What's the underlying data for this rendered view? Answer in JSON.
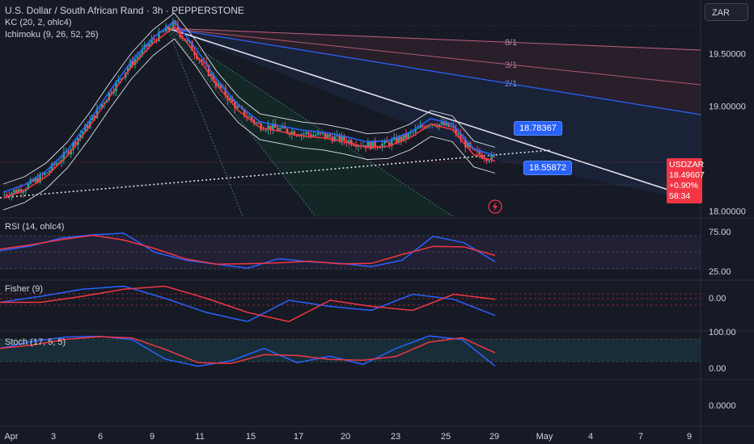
{
  "header": {
    "symbol_line": "U.S. Dollar / South African Rand · 3h · PEPPERSTONE",
    "kc_label": "KC (20, 2, ohlc4)",
    "ichimoku_label": "Ichimoku (9, 26, 52, 26)"
  },
  "currency_button": "ZAR",
  "price_tag": {
    "symbol": "USDZAR",
    "price": "18.49607",
    "change": "+0.90%",
    "countdown": "58:34"
  },
  "annotations": {
    "upper_box": "18.78367",
    "lower_box": "18.55872",
    "fan_labels": [
      "8/1",
      "3/1",
      "2/1"
    ]
  },
  "panes": {
    "rsi": {
      "title": "RSI (14, ohlc4)",
      "ticks": [
        "75.00",
        "25.00"
      ]
    },
    "fisher": {
      "title": "Fisher (9)",
      "ticks": [
        "0.00"
      ]
    },
    "stoch": {
      "title": "Stoch (17, 5, 5)",
      "ticks": [
        "100.00",
        "0.00"
      ]
    },
    "empty": {
      "ticks": [
        "0.0000"
      ]
    }
  },
  "colors": {
    "background": "#161a25",
    "up": "#26a69a",
    "down": "#ef5350",
    "blue": "#2962ff",
    "red": "#f23645"
  },
  "chart_data": {
    "type": "line",
    "title": "U.S. Dollar / South African Rand · 3h · PEPPERSTONE",
    "x_tick_labels": [
      "Apr",
      "3",
      "6",
      "9",
      "11",
      "15",
      "17",
      "20",
      "23",
      "25",
      "29",
      "May",
      "4",
      "7",
      "9"
    ],
    "y_ticks": [
      "19.50000",
      "19.00000",
      "18.00000"
    ],
    "y_range": [
      17.95,
      19.95
    ],
    "series": [
      {
        "values": [
          18.15,
          18.22,
          18.35,
          18.55,
          18.82,
          19.12,
          19.4,
          19.62,
          19.78,
          19.52,
          19.22,
          18.98,
          18.82,
          18.78,
          18.74,
          18.72,
          18.68,
          18.63,
          18.64,
          18.72,
          18.85,
          18.8,
          18.56,
          18.5
        ]
      }
    ],
    "rsi": [
      52,
      58,
      68,
      72,
      74,
      50,
      40,
      35,
      30,
      42,
      38,
      36,
      32,
      40,
      70,
      62,
      38
    ],
    "fisher": [
      0.2,
      0.8,
      1.5,
      1.8,
      0.6,
      -0.8,
      -1.7,
      0.4,
      -0.2,
      -0.6,
      1.0,
      0.5,
      -1.1
    ],
    "stoch": [
      60,
      80,
      92,
      94,
      85,
      30,
      10,
      25,
      60,
      20,
      38,
      15,
      60,
      95,
      85,
      10
    ]
  }
}
